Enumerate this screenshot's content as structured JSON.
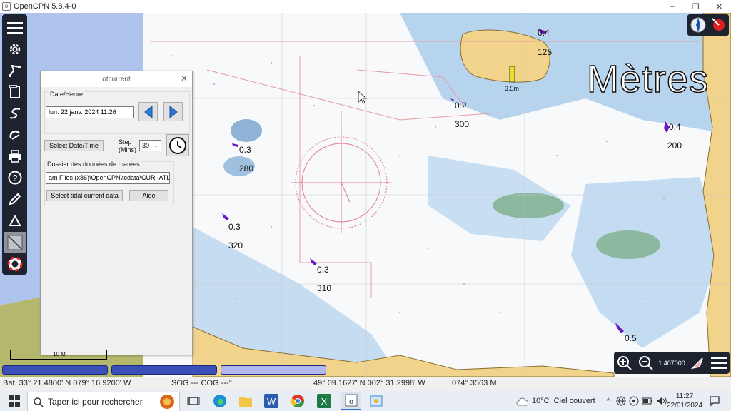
{
  "window": {
    "title": "OpenCPN 5.8.4-0",
    "app_icon": "opencpn-icon",
    "minimize": "–",
    "restore": "❐",
    "close": "✕"
  },
  "dialog": {
    "title": "otcurrent",
    "date_group_label": "Date/Heure",
    "date_value": "lun. 22 janv. 2024 11:26",
    "select_date_button": "Select Date/Time",
    "step_label_1": "Step",
    "step_label_2": "(Mins)",
    "step_value": "30",
    "folder_group_label": "Dossier des données de marées",
    "folder_value": "am Files (x86)\\OpenCPN\\tcdata\\CUR_ATL",
    "select_tidal_button": "Select tidal current data",
    "help_button": "Aide"
  },
  "chart": {
    "units_label": "Mètres",
    "tide_gauge_label": "3.5m",
    "scale_bar_label": "10 M",
    "scale_value": "1:407000",
    "currents": [
      {
        "speed": "0.4",
        "direction": "125"
      },
      {
        "speed": "0.2",
        "direction": "300"
      },
      {
        "speed": "0.4",
        "direction": "200"
      },
      {
        "speed": "0.3",
        "direction": "280"
      },
      {
        "speed": "0.3",
        "direction": "320"
      },
      {
        "speed": "0.3",
        "direction": "310"
      },
      {
        "speed": "0.5",
        "direction": ""
      }
    ]
  },
  "statusbar": {
    "boat": "Bat. 33° 21.4800' N   079° 16.9200' W",
    "sog_cog": "SOG --- COG ---°",
    "cursor": "49° 09.1627' N   002° 31.2998' W",
    "bearing": "074°  3563 M"
  },
  "taskbar": {
    "search_placeholder": "Taper ici pour rechercher",
    "weather_temp": "10°C",
    "weather_desc": "Ciel couvert",
    "time": "11:27",
    "date": "22/01/2024",
    "caret": "^"
  },
  "colors": {
    "toolbar_bg": "#1d2430",
    "land": "#f1d38c",
    "shallow": "#9fc7e8",
    "current_arrow": "#6a18c8"
  }
}
